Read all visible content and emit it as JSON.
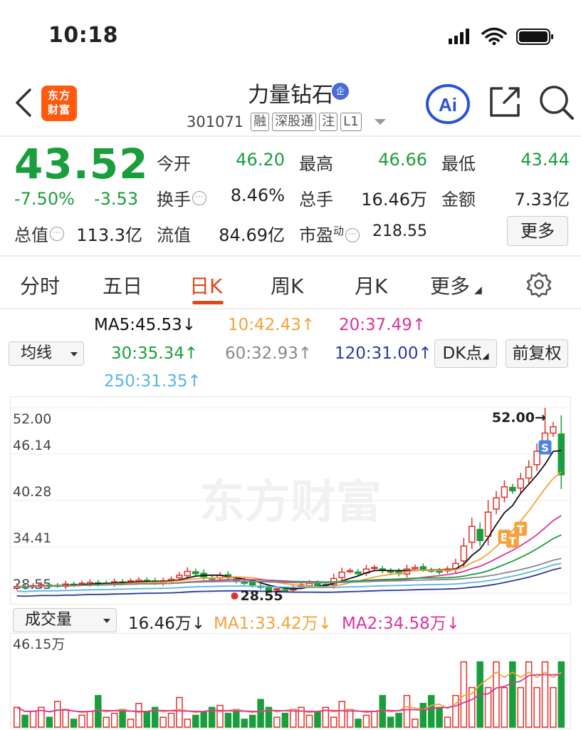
{
  "status": {
    "time": "10:18"
  },
  "header": {
    "logo_line1": "东方",
    "logo_line2": "财富",
    "title": "力量钻石",
    "title_badge": "企",
    "code": "301071",
    "tags": [
      "融",
      "深股通",
      "注",
      "L1"
    ],
    "ai_label": "Ai"
  },
  "quote": {
    "price": "43.52",
    "change_pct": "-7.50%",
    "change": "-3.53",
    "open_label": "今开",
    "open": "46.20",
    "high_label": "最高",
    "high": "46.66",
    "low_label": "最低",
    "low": "43.44",
    "turnover_label": "换手",
    "turnover": "8.46%",
    "volume_label": "总手",
    "volume": "16.46万",
    "amount_label": "金额",
    "amount": "7.33亿",
    "mktcap_label": "总值",
    "mktcap": "113.3亿",
    "float_label": "流值",
    "float": "84.69亿",
    "pe_label": "市盈",
    "pe_sup": "动",
    "pe": "218.55",
    "more": "更多"
  },
  "tabs": [
    "分时",
    "五日",
    "日K",
    "周K",
    "月K",
    "更多"
  ],
  "active_tab": "日K",
  "ma_legend": {
    "selector": "均线",
    "ma5": "MA5:45.53↓",
    "ma10": "10:42.43↑",
    "ma20": "20:37.49↑",
    "ma30": "30:35.34↑",
    "ma60": "60:32.93↑",
    "ma120": "120:31.00↑",
    "ma250": "250:31.35↑",
    "dk": "DK点",
    "adjust": "前复权"
  },
  "colors": {
    "up": "#e0312b",
    "down": "#1a9e3c",
    "accent": "#e2461c",
    "ma5": "#111111",
    "ma10": "#f2a33a",
    "ma20": "#d9349c",
    "ma30": "#1a9e3c",
    "ma60": "#888888",
    "ma120": "#2a3a9e",
    "ma250": "#59b4e8"
  },
  "chart_data": [
    {
      "type": "candlestick",
      "y_ticks": [
        "52.00",
        "46.14",
        "40.28",
        "34.41",
        "28.55"
      ],
      "ylim": [
        28.55,
        52.0
      ],
      "max_label": "52.00→",
      "min_label": "28.55",
      "watermark": "东方财富",
      "markers": [
        "B",
        "T",
        "T",
        "S"
      ],
      "closes": [
        29.4,
        29.3,
        29.5,
        29.6,
        29.4,
        29.5,
        29.7,
        29.6,
        29.8,
        29.9,
        29.7,
        29.8,
        30.0,
        29.9,
        30.1,
        30.2,
        30.0,
        29.9,
        30.1,
        30.3,
        30.8,
        31.3,
        31.0,
        30.6,
        30.4,
        30.8,
        30.5,
        30.1,
        29.8,
        29.6,
        29.3,
        28.9,
        29.1,
        28.9,
        29.2,
        29.6,
        29.8,
        29.5,
        29.6,
        30.4,
        31.2,
        31.4,
        31.0,
        31.6,
        31.8,
        31.4,
        31.2,
        31.0,
        31.6,
        31.8,
        31.6,
        31.4,
        31.2,
        31.6,
        32.3,
        34.5,
        37.0,
        35.2,
        38.8,
        40.6,
        42.0,
        41.5,
        43.0,
        44.5,
        46.5,
        48.8,
        49.6,
        43.52
      ]
    },
    {
      "type": "bar",
      "selector": "成交量",
      "vol": "16.46万↓",
      "ma1": "MA1:33.42万↓",
      "ma2": "MA2:34.58万↓",
      "y_top_label": "46.15万",
      "ylim": [
        0,
        46.15
      ]
    }
  ]
}
